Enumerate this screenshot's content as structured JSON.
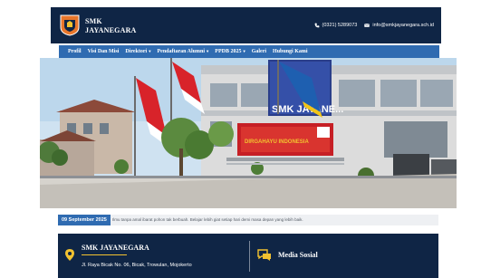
{
  "header": {
    "brand_line1": "SMK",
    "brand_line2": "JAYANEGARA",
    "phone": "(0321) 5289073",
    "email": "info@smkjayanegara.sch.id",
    "bg_color": "#0f2545"
  },
  "nav": {
    "items": [
      {
        "label": "Profil",
        "dropdown": false
      },
      {
        "label": "Visi Dan Misi",
        "dropdown": false
      },
      {
        "label": "Direktori",
        "dropdown": true
      },
      {
        "label": "Pendaftaran Alumni",
        "dropdown": true
      },
      {
        "label": "PPDB 2025",
        "dropdown": true
      },
      {
        "label": "Galeri",
        "dropdown": false
      },
      {
        "label": "Hubungi Kami",
        "dropdown": false
      }
    ],
    "chevron": "▾",
    "bg_color": "#2f6bb1"
  },
  "hero": {
    "signboard_text": "SMK JAYANE...",
    "banner_text": "DIRGAHAYU INDONESIA",
    "icon": "school-building-photo"
  },
  "ticker": {
    "date": "09 September 2025",
    "text": "Ilmu tanpa amal ibarat pohon tak berbuah. Belajar lebih giat setiap hari demi masa depan yang lebih baik."
  },
  "footer": {
    "school_name": "SMK JAYANEGARA",
    "address": "Jl. Raya Bicak No. 06, Bicak, Trowulan, Mojokerto",
    "social_title": "Media Sosial",
    "accent_color": "#f2c230"
  }
}
